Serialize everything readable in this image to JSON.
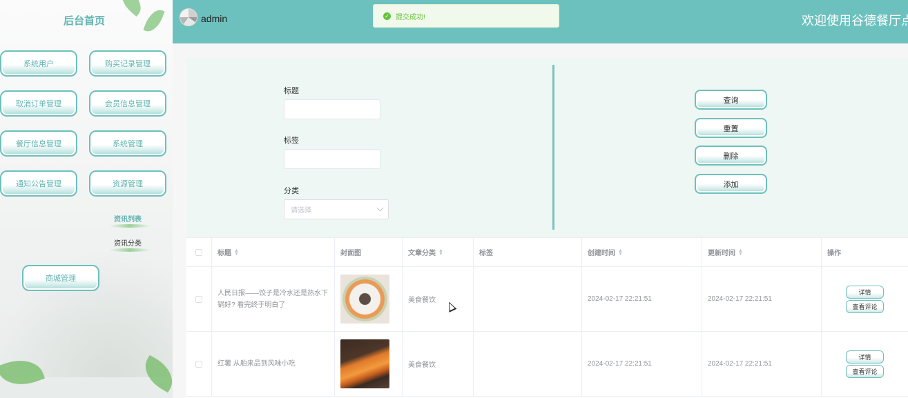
{
  "sidebar": {
    "home_title": "后台首页",
    "menu": [
      "系统用户",
      "购买记录管理",
      "取消订单管理",
      "会员信息管理",
      "餐厅信息管理",
      "系统管理",
      "通知公告管理",
      "资源管理"
    ],
    "sub_items": [
      "资讯列表",
      "资讯分类"
    ],
    "mall": "商城管理"
  },
  "header": {
    "username": "admin",
    "welcome": "欢迎使用谷德餐厅点餐"
  },
  "toast": {
    "message": "提交成功!"
  },
  "search": {
    "title_label": "标题",
    "tag_label": "标签",
    "category_label": "分类",
    "category_placeholder": "请选择",
    "buttons": [
      "查询",
      "重置",
      "删除",
      "添加"
    ]
  },
  "table": {
    "headers": [
      "标题",
      "封面图",
      "文章分类",
      "标签",
      "创建时间",
      "更新时间",
      "操作"
    ],
    "rows": [
      {
        "title": "人民日报——饺子是冷水还是热水下锅好? 看完终于明白了",
        "category": "美食餐饮",
        "tag": "",
        "created": "2024-02-17 22:21:51",
        "updated": "2024-02-17 22:21:51"
      },
      {
        "title": "红薯 从舶来品到风味小吃",
        "category": "美食餐饮",
        "tag": "",
        "created": "2024-02-17 22:21:51",
        "updated": "2024-02-17 22:21:51"
      }
    ],
    "op_detail": "详情",
    "op_comments": "查看评论"
  }
}
